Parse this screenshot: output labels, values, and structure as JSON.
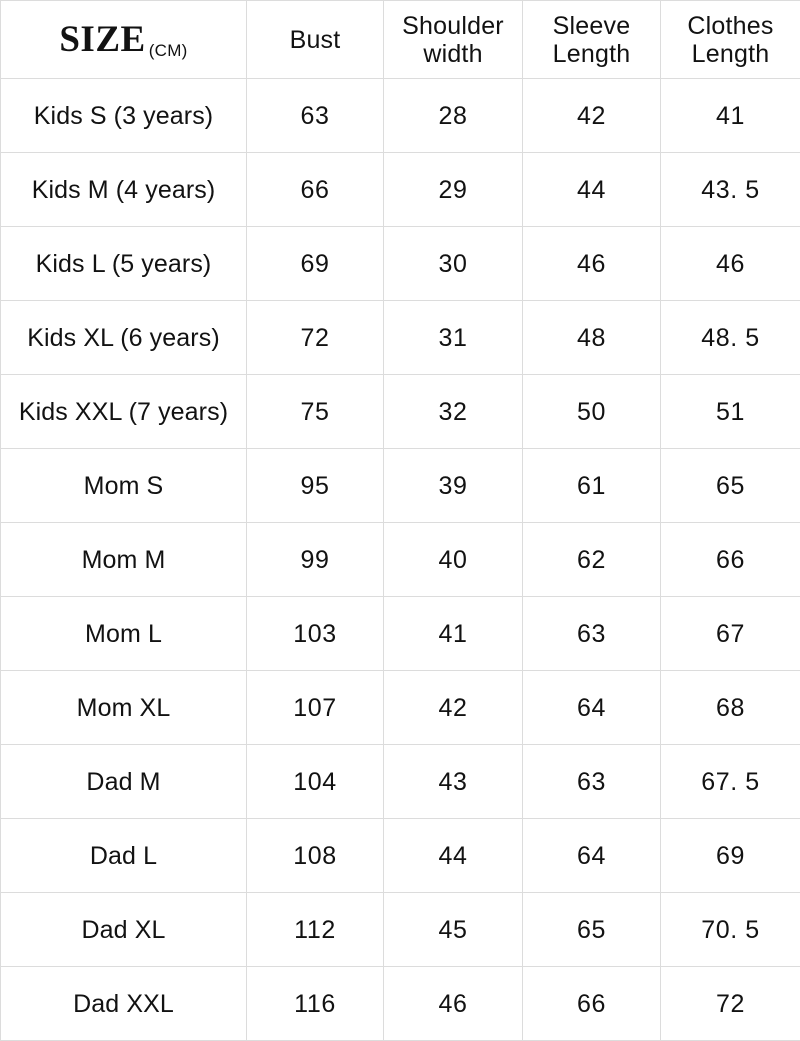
{
  "table": {
    "headers": [
      {
        "main": "SIZE",
        "unit": "(CM)"
      },
      {
        "main": "Bust"
      },
      {
        "main": "Shoulder width"
      },
      {
        "main": "Sleeve Length"
      },
      {
        "main": "Clothes Length"
      }
    ],
    "rows": [
      {
        "size": "Kids S (3 years)",
        "bust": "63",
        "shoulder_width": "28",
        "sleeve_length": "42",
        "clothes_length": "41"
      },
      {
        "size": "Kids M (4 years)",
        "bust": "66",
        "shoulder_width": "29",
        "sleeve_length": "44",
        "clothes_length": "43. 5"
      },
      {
        "size": "Kids L (5 years)",
        "bust": "69",
        "shoulder_width": "30",
        "sleeve_length": "46",
        "clothes_length": "46"
      },
      {
        "size": "Kids XL (6 years)",
        "bust": "72",
        "shoulder_width": "31",
        "sleeve_length": "48",
        "clothes_length": "48. 5"
      },
      {
        "size": "Kids XXL (7 years)",
        "bust": "75",
        "shoulder_width": "32",
        "sleeve_length": "50",
        "clothes_length": "51"
      },
      {
        "size": "Mom S",
        "bust": "95",
        "shoulder_width": "39",
        "sleeve_length": "61",
        "clothes_length": "65"
      },
      {
        "size": "Mom M",
        "bust": "99",
        "shoulder_width": "40",
        "sleeve_length": "62",
        "clothes_length": "66"
      },
      {
        "size": "Mom L",
        "bust": "103",
        "shoulder_width": "41",
        "sleeve_length": "63",
        "clothes_length": "67"
      },
      {
        "size": "Mom XL",
        "bust": "107",
        "shoulder_width": "42",
        "sleeve_length": "64",
        "clothes_length": "68"
      },
      {
        "size": "Dad M",
        "bust": "104",
        "shoulder_width": "43",
        "sleeve_length": "63",
        "clothes_length": "67. 5"
      },
      {
        "size": "Dad L",
        "bust": "108",
        "shoulder_width": "44",
        "sleeve_length": "64",
        "clothes_length": "69"
      },
      {
        "size": "Dad XL",
        "bust": "112",
        "shoulder_width": "45",
        "sleeve_length": "65",
        "clothes_length": "70. 5"
      },
      {
        "size": "Dad XXL",
        "bust": "116",
        "shoulder_width": "46",
        "sleeve_length": "66",
        "clothes_length": "72"
      }
    ]
  },
  "style": {
    "grid_color": "#dcdcdc",
    "text_color": "#121212",
    "background": "#ffffff"
  }
}
